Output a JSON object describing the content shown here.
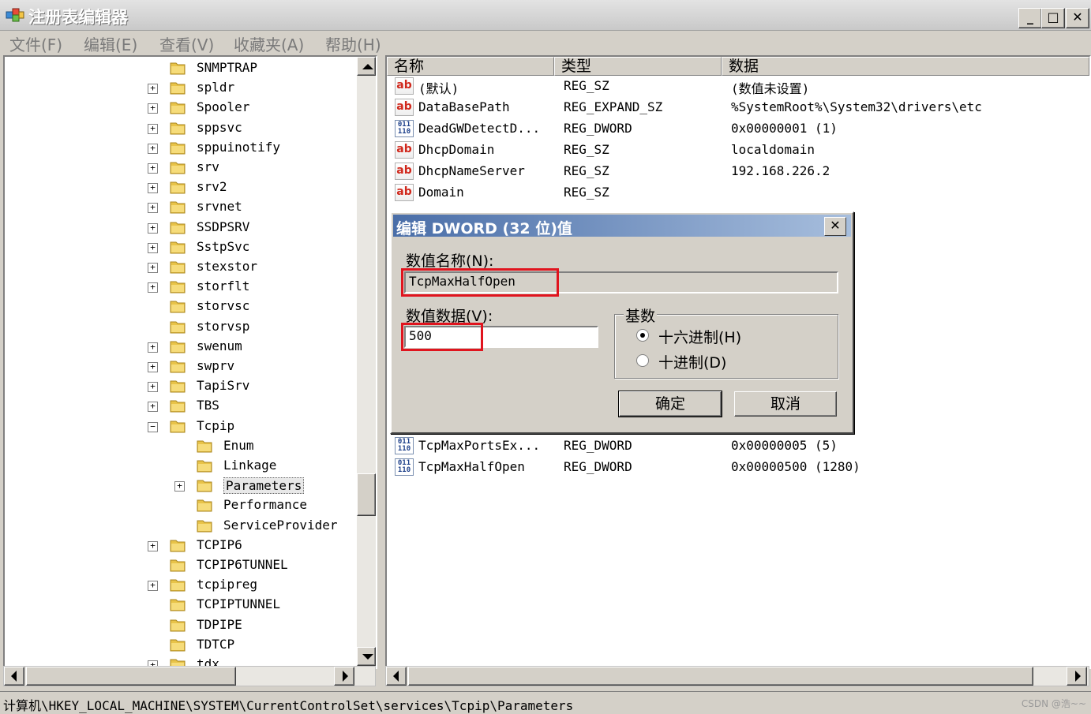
{
  "window": {
    "title": "注册表编辑器",
    "min": "_",
    "max": "□",
    "close": "✕"
  },
  "menu": [
    {
      "label": "文件(F)"
    },
    {
      "label": "编辑(E)"
    },
    {
      "label": "查看(V)"
    },
    {
      "label": "收藏夹(A)"
    },
    {
      "label": "帮助(H)"
    }
  ],
  "tree": [
    {
      "label": "SNMPTRAP",
      "level": 0,
      "expander": ""
    },
    {
      "label": "spldr",
      "level": 0,
      "expander": "+"
    },
    {
      "label": "Spooler",
      "level": 0,
      "expander": "+"
    },
    {
      "label": "sppsvc",
      "level": 0,
      "expander": "+"
    },
    {
      "label": "sppuinotify",
      "level": 0,
      "expander": "+"
    },
    {
      "label": "srv",
      "level": 0,
      "expander": "+"
    },
    {
      "label": "srv2",
      "level": 0,
      "expander": "+"
    },
    {
      "label": "srvnet",
      "level": 0,
      "expander": "+"
    },
    {
      "label": "SSDPSRV",
      "level": 0,
      "expander": "+"
    },
    {
      "label": "SstpSvc",
      "level": 0,
      "expander": "+"
    },
    {
      "label": "stexstor",
      "level": 0,
      "expander": "+"
    },
    {
      "label": "storflt",
      "level": 0,
      "expander": "+"
    },
    {
      "label": "storvsc",
      "level": 0,
      "expander": ""
    },
    {
      "label": "storvsp",
      "level": 0,
      "expander": ""
    },
    {
      "label": "swenum",
      "level": 0,
      "expander": "+"
    },
    {
      "label": "swprv",
      "level": 0,
      "expander": "+"
    },
    {
      "label": "TapiSrv",
      "level": 0,
      "expander": "+"
    },
    {
      "label": "TBS",
      "level": 0,
      "expander": "+"
    },
    {
      "label": "Tcpip",
      "level": 0,
      "expander": "−"
    },
    {
      "label": "Enum",
      "level": 1,
      "expander": ""
    },
    {
      "label": "Linkage",
      "level": 1,
      "expander": ""
    },
    {
      "label": "Parameters",
      "level": 1,
      "expander": "+",
      "selected": true
    },
    {
      "label": "Performance",
      "level": 1,
      "expander": ""
    },
    {
      "label": "ServiceProvider",
      "level": 1,
      "expander": ""
    },
    {
      "label": "TCPIP6",
      "level": 0,
      "expander": "+"
    },
    {
      "label": "TCPIP6TUNNEL",
      "level": 0,
      "expander": ""
    },
    {
      "label": "tcpipreg",
      "level": 0,
      "expander": "+"
    },
    {
      "label": "TCPIPTUNNEL",
      "level": 0,
      "expander": ""
    },
    {
      "label": "TDPIPE",
      "level": 0,
      "expander": ""
    },
    {
      "label": "TDTCP",
      "level": 0,
      "expander": ""
    },
    {
      "label": "tdx",
      "level": 0,
      "expander": "+"
    }
  ],
  "columns": {
    "name": "名称",
    "type": "类型",
    "data": "数据"
  },
  "values": [
    {
      "icon": "string",
      "name": "(默认)",
      "type": "REG_SZ",
      "data": "(数值未设置)"
    },
    {
      "icon": "string",
      "name": "DataBasePath",
      "type": "REG_EXPAND_SZ",
      "data": "%SystemRoot%\\System32\\drivers\\etc"
    },
    {
      "icon": "binary",
      "name": "DeadGWDetectD...",
      "type": "REG_DWORD",
      "data": "0x00000001 (1)"
    },
    {
      "icon": "string",
      "name": "DhcpDomain",
      "type": "REG_SZ",
      "data": "localdomain"
    },
    {
      "icon": "string",
      "name": "DhcpNameServer",
      "type": "REG_SZ",
      "data": "192.168.226.2"
    },
    {
      "icon": "string",
      "name": "Domain",
      "type": "REG_SZ",
      "data": ""
    }
  ],
  "values_after": [
    {
      "icon": "binary",
      "name": "TcpMaxPortsEx...",
      "type": "REG_DWORD",
      "data": "0x00000005 (5)"
    },
    {
      "icon": "binary",
      "name": "TcpMaxHalfOpen",
      "type": "REG_DWORD",
      "data": "0x00000500 (1280)"
    }
  ],
  "dialog": {
    "title": "编辑 DWORD (32 位)值",
    "name_label": "数值名称(N):",
    "name_value": "TcpMaxHalfOpen",
    "data_label": "数值数据(V):",
    "data_value": "500",
    "base_label": "基数",
    "hex_label": "十六进制(H)",
    "dec_label": "十进制(D)",
    "selected_base": "hex",
    "ok": "确定",
    "cancel": "取消",
    "close": "✕"
  },
  "status": {
    "path": "计算机\\HKEY_LOCAL_MACHINE\\SYSTEM\\CurrentControlSet\\services\\Tcpip\\Parameters",
    "watermark": "CSDN @浩~~"
  },
  "colors": {
    "highlight": "#e0141e",
    "dialog_title_start": "#4a6ea8",
    "folder": "#e8c349"
  }
}
